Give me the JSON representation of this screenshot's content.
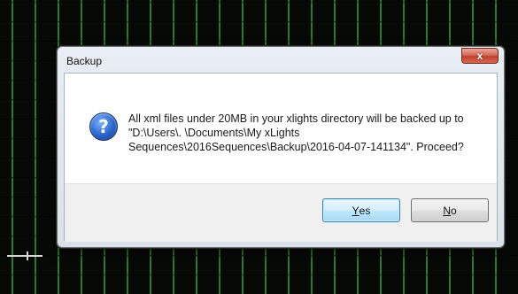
{
  "dialog": {
    "title": "Backup",
    "close_glyph": "x",
    "icon": "question-icon",
    "message_lines": [
      "All xml files under 20MB in your xlights directory will be backed up to",
      "\"D:\\Users\\.            \\Documents\\My xLights",
      "Sequences\\2016Sequences\\Backup\\2016-04-07-141134\". Proceed?"
    ],
    "yes_accel": "Y",
    "yes_rest": "es",
    "no_accel": "N",
    "no_rest": "o"
  },
  "colors": {
    "background_grid": "#2f7a2f",
    "background": "#070907",
    "close_button": "#c0412e",
    "default_button_border": "#3c7fb1"
  }
}
